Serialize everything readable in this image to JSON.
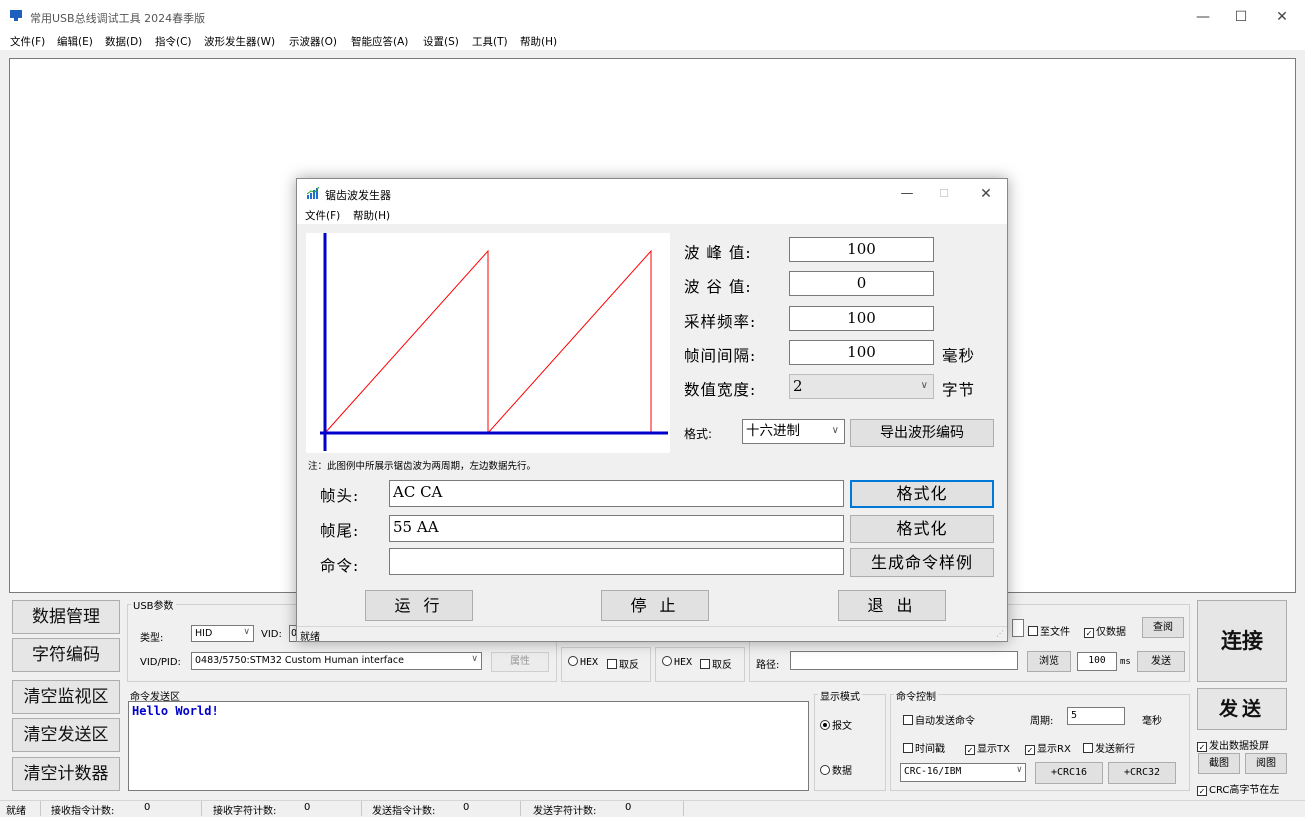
{
  "app": {
    "title": "常用USB总线调试工具 2024春季版"
  },
  "window_controls": {
    "minimize": "—",
    "maximize": "☐",
    "close": "✕"
  },
  "menu": [
    "文件(F)",
    "编辑(E)",
    "数据(D)",
    "指令(C)",
    "波形发生器(W)",
    "示波器(O)",
    "智能应答(A)",
    "设置(S)",
    "工具(T)",
    "帮助(H)"
  ],
  "left_buttons": [
    "数据管理",
    "字符编码",
    "清空监视区",
    "清空发送区",
    "清空计数器"
  ],
  "usb_params": {
    "group_label": "USB参数",
    "type_label": "类型:",
    "type_value": "HID",
    "vid_label": "VID:",
    "vid_value": "0",
    "vidpid_label": "VID/PID:",
    "vidpid_value": "0483/5750:STM32 Custom Human interface",
    "props_button": "属性"
  },
  "options_row": {
    "hex1": "HEX",
    "invert1": "取反",
    "hex2": "HEX",
    "invert2": "取反",
    "to_file": "至文件",
    "only_data": "仅数据",
    "view_button": "查阅",
    "path_label": "路径:",
    "path_value": "",
    "browse_button": "浏览",
    "interval_value": "100",
    "interval_unit": "ms",
    "send_button": "发送"
  },
  "send_area": {
    "label": "命令发送区",
    "text": "Hello World!"
  },
  "display_mode": {
    "label": "显示模式",
    "text_mode": "报文",
    "data_mode": "数据"
  },
  "command_control": {
    "label": "命令控制",
    "auto_send": "自动发送命令",
    "period_label": "周期:",
    "period_value": "5",
    "period_unit": "毫秒",
    "timestamp": "时间戳",
    "show_tx": "显示TX",
    "show_rx": "显示RX",
    "send_newline": "发送新行",
    "crc_value": "CRC-16/IBM",
    "crc16_button": "+CRC16",
    "crc32_button": "+CRC32"
  },
  "right_panel": {
    "connect": "连接",
    "send": "发送",
    "send_data_project": "发出数据投屏",
    "screenshot": "截图",
    "view_image": "阅图",
    "crc_high_left": "CRC高字节在左"
  },
  "statusbar": {
    "ready": "就绪",
    "recv_cmd_label": "接收指令计数:",
    "recv_cmd_value": "0",
    "recv_char_label": "接收字符计数:",
    "recv_char_value": "0",
    "send_cmd_label": "发送指令计数:",
    "send_cmd_value": "0",
    "send_char_label": "发送字符计数:",
    "send_char_value": "0"
  },
  "dialog": {
    "title": "锯齿波发生器",
    "menu": [
      "文件(F)",
      "帮助(H)"
    ],
    "peak_label": "波 峰 值:",
    "peak_value": "100",
    "valley_label": "波 谷 值:",
    "valley_value": "0",
    "sample_label": "采样频率:",
    "sample_value": "100",
    "interval_label": "帧间间隔:",
    "interval_value": "100",
    "interval_unit": "毫秒",
    "width_label": "数值宽度:",
    "width_value": "2",
    "width_unit": "字节",
    "format_label": "格式:",
    "format_value": "十六进制",
    "export_button": "导出波形编码",
    "note": "注：此图例中所展示锯齿波为两周期，左边数据先行。",
    "header_label": "帧头:",
    "header_value": "AC CA",
    "tail_label": "帧尾:",
    "tail_value": "55 AA",
    "command_label": "命令:",
    "command_value": "",
    "format_button": "格式化",
    "format_button2": "格式化",
    "gen_button": "生成命令样例",
    "run_button": "运 行",
    "stop_button": "停 止",
    "exit_button": "退 出",
    "status": "就绪",
    "wave": {
      "peak": 100,
      "valley": 0,
      "periods": 2
    },
    "colors": {
      "axis": "#0000cc",
      "wave": "#ff0000"
    }
  }
}
